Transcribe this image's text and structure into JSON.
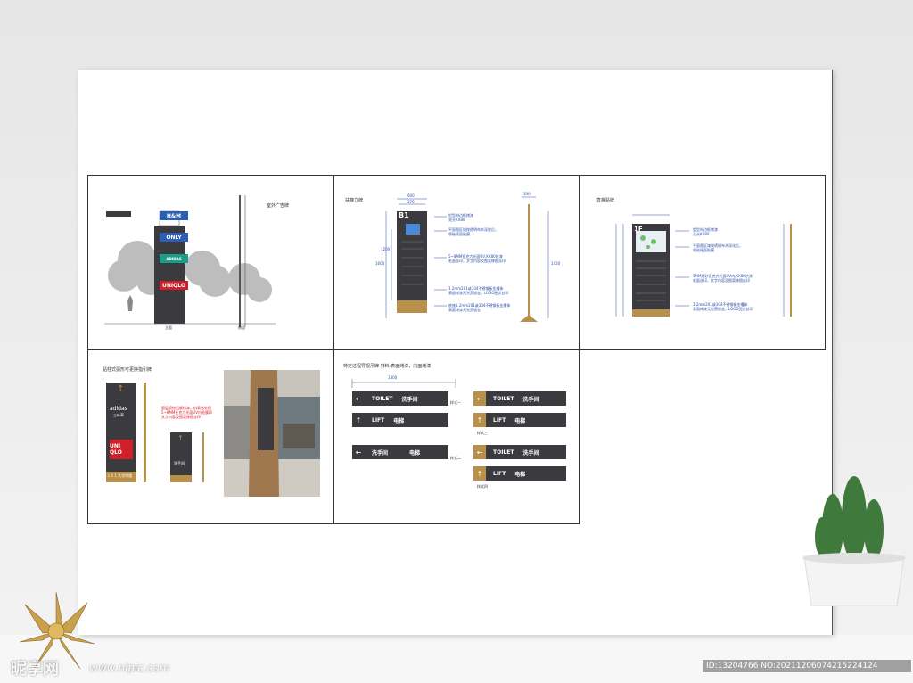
{
  "panels": {
    "outdoor": {
      "caption": "室外广告牌",
      "ground_label": "立面",
      "side_label": "侧面",
      "brands": [
        "H&M",
        "ONLY",
        "ADIDAS",
        "UNIQLO"
      ]
    },
    "escalator": {
      "caption": "扶梯立牌",
      "floor": "B1",
      "dims": [
        "600",
        "370",
        "330",
        "1600",
        "1200",
        "1420"
      ],
      "notes": [
        "铝型材边框烤漆",
        "亮光KX80",
        "平面图区域按透明布木深化后，",
        "喷绘裱面贴膜",
        "5~8MM亚克力光面UV,KX80烘漆",
        "毛面丝印，文字内容及图案移图丝印",
        "1.2mm201或304不锈钢板金槽体",
        "表面烤漆无光黑钣金，LOGO图文丝印",
        "底座1.2mm201或304不锈钢板金槽体",
        "表面烤漆无光黑钣金"
      ]
    },
    "elevator": {
      "caption": "直梯贴牌",
      "floor": "1F",
      "notes": [
        "铝型材边框烤漆",
        "无光KX80",
        "平面图区域按透明布木深化后，",
        "喷绘裱面贴膜",
        "5MM磨砂亚克力光面UV内,KX80烘漆",
        "毛面丝印，文字内容及图案移图丝印",
        "1.2mm201或304不锈钢板金槽体",
        "表面烤漆无光黑钣金，LOGO图文丝印"
      ]
    },
    "wall": {
      "caption": "贴柱式弧形可更换指引牌",
      "brands": [
        "adidas",
        "UNI QLO"
      ],
      "sub": "三叶草",
      "bottom": "L 5 1 大学明楼",
      "small_label": "洗手间",
      "red_notes": [
        "面层喷绘铝板烤漆，抗氧化处理",
        "5~8MM亚克力光面UV内贴膜印",
        "文字内容及图案移图丝印"
      ]
    },
    "hanging": {
      "caption": "特定过程导视吊牌  材料:表面烤漆，内面烤漆",
      "dim": "1300",
      "styles": [
        "样式一",
        "样式二",
        "样式三",
        "样式四"
      ],
      "toilet_en": "TOILET",
      "toilet_cn": "洗手间",
      "lift_en": "LIFT",
      "lift_cn": "电梯"
    }
  },
  "watermark": {
    "brand": "昵享网",
    "url": "www.nipic.com",
    "id_text": "ID:13204766 NO:20211206074215224124"
  },
  "colors": {
    "dark": "#3b3b3f",
    "gold": "#b8904a",
    "blue": "#2a4fa8"
  }
}
